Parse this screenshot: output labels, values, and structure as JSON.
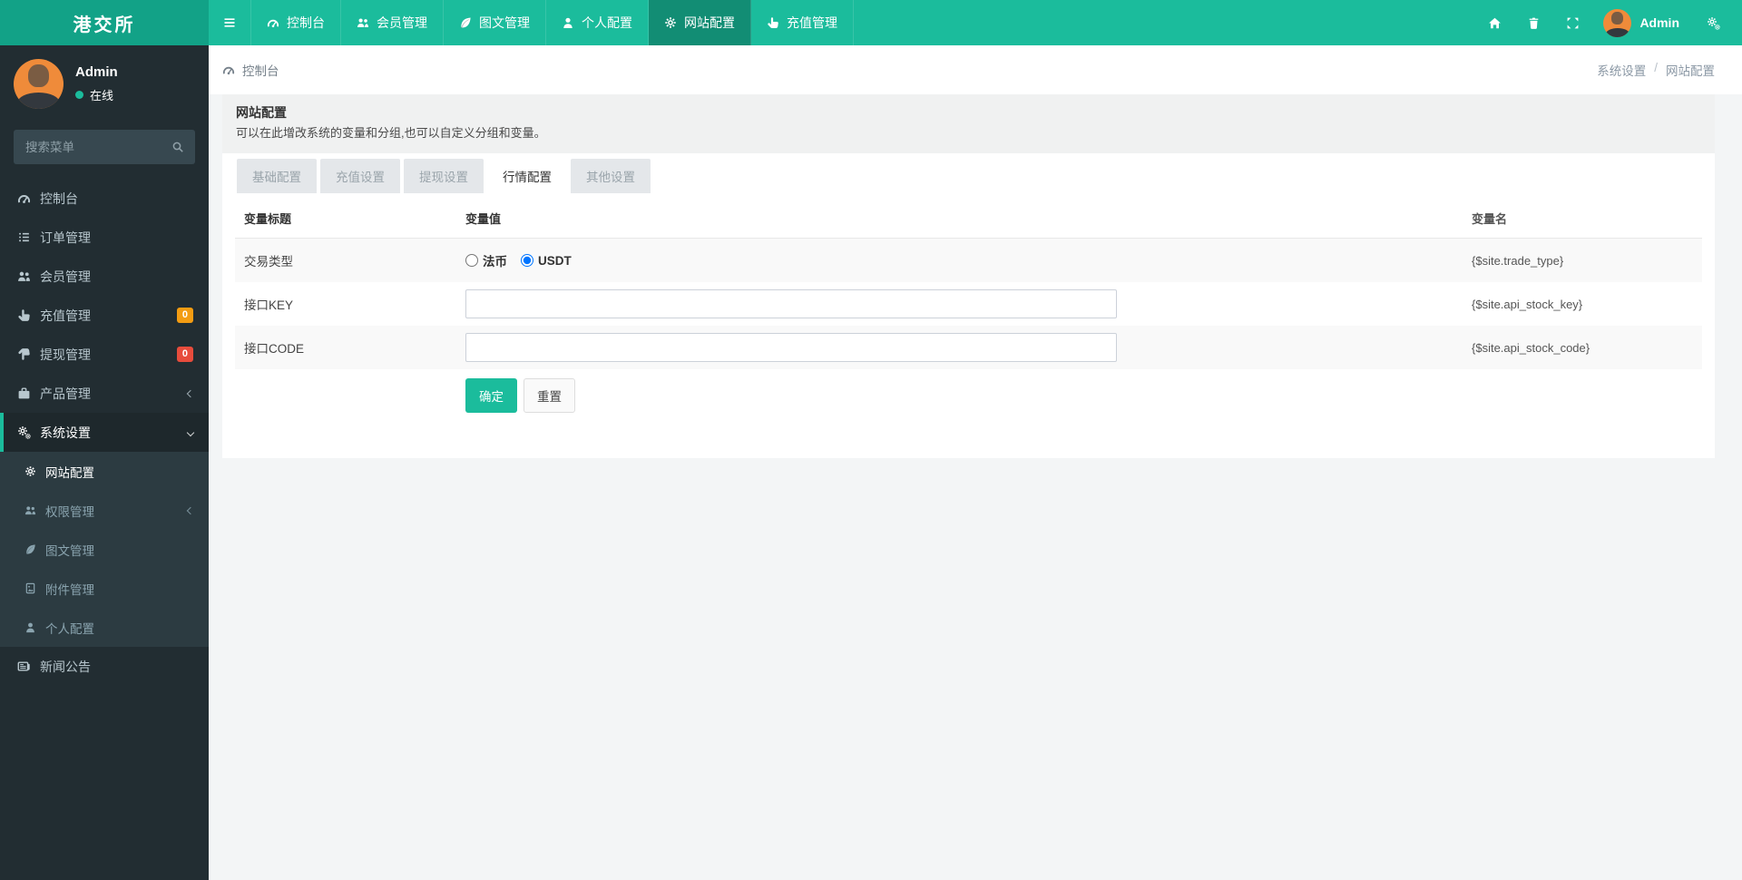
{
  "brand": {
    "title": "港交所"
  },
  "colors": {
    "navbar": "#1bbc9c",
    "navbar_logo": "#12a287",
    "navbar_active": "#128d74",
    "sidebar": "#222d32",
    "sidebar_submenu": "#2c3b41",
    "sidebar_active_bg": "#1e282c",
    "accent": "#1bbc9c",
    "badge_recharge": "#f39c12",
    "badge_withdraw": "#e74c3c",
    "submit_button": "#1bbc9c"
  },
  "navbar": {
    "toggle_icon": "bars-icon",
    "items": [
      {
        "key": "dashboard",
        "icon": "gauge-icon",
        "label": "控制台"
      },
      {
        "key": "members",
        "icon": "users-icon",
        "label": "会员管理"
      },
      {
        "key": "content",
        "icon": "leaf-icon",
        "label": "图文管理"
      },
      {
        "key": "profile",
        "icon": "user-icon",
        "label": "个人配置"
      },
      {
        "key": "site-config",
        "icon": "gear-icon",
        "label": "网站配置",
        "active": true
      },
      {
        "key": "recharge",
        "icon": "hand-up-icon",
        "label": "充值管理"
      }
    ],
    "right": {
      "icons": [
        "home-icon",
        "trash-icon",
        "fullscreen-icon"
      ],
      "username": "Admin",
      "menu_icon": "cogs-icon"
    }
  },
  "sidebar": {
    "user": {
      "name": "Admin",
      "status": "在线"
    },
    "search_placeholder": "搜索菜单",
    "items": [
      {
        "key": "dashboard",
        "icon": "gauge-icon",
        "label": "控制台"
      },
      {
        "key": "orders",
        "icon": "list-icon",
        "label": "订单管理"
      },
      {
        "key": "members",
        "icon": "users-icon",
        "label": "会员管理"
      },
      {
        "key": "recharge",
        "icon": "hand-up-icon",
        "label": "充值管理",
        "badge": "0",
        "badge_color": "#f39c12"
      },
      {
        "key": "withdraw",
        "icon": "hand-down-icon",
        "label": "提现管理",
        "badge": "0",
        "badge_color": "#e74c3c"
      },
      {
        "key": "products",
        "icon": "suitcase-icon",
        "label": "产品管理",
        "chevron": "left"
      },
      {
        "key": "system-settings",
        "icon": "cogs-icon",
        "label": "系统设置",
        "chevron": "down",
        "active": true,
        "children": [
          {
            "key": "site-config",
            "icon": "gear-icon",
            "label": "网站配置",
            "active": true
          },
          {
            "key": "permissions",
            "icon": "users-icon",
            "label": "权限管理",
            "chevron": "left"
          },
          {
            "key": "content",
            "icon": "leaf-icon",
            "label": "图文管理"
          },
          {
            "key": "attachments",
            "icon": "file-image-icon",
            "label": "附件管理"
          },
          {
            "key": "profile",
            "icon": "user-icon",
            "label": "个人配置"
          }
        ]
      },
      {
        "key": "news",
        "icon": "newspaper-icon",
        "label": "新闻公告"
      }
    ]
  },
  "breadcrumb": {
    "left": "控制台",
    "left_icon": "gauge-icon",
    "path": [
      "系统设置",
      "网站配置"
    ],
    "separator": "/"
  },
  "panel": {
    "title": "网站配置",
    "description": "可以在此增改系统的变量和分组,也可以自定义分组和变量。"
  },
  "tabs": [
    {
      "key": "basic",
      "label": "基础配置"
    },
    {
      "key": "recharge",
      "label": "充值设置"
    },
    {
      "key": "withdraw",
      "label": "提现设置"
    },
    {
      "key": "market",
      "label": "行情配置",
      "active": true
    },
    {
      "key": "other",
      "label": "其他设置"
    }
  ],
  "table": {
    "headers": [
      "变量标题",
      "变量值",
      "变量名"
    ],
    "rows": [
      {
        "title": "交易类型",
        "type": "radio",
        "var": "{$site.trade_type}",
        "options": [
          {
            "key": "fiat",
            "label": "法币",
            "checked": false
          },
          {
            "key": "usdt",
            "label": "USDT",
            "checked": true
          }
        ]
      },
      {
        "title": "接口KEY",
        "type": "text",
        "value": "",
        "input_name": "api-key-input",
        "var": "{$site.api_stock_key}"
      },
      {
        "title": "接口CODE",
        "type": "text",
        "value": "",
        "input_name": "api-code-input",
        "var": "{$site.api_stock_code}"
      }
    ]
  },
  "buttons": {
    "submit": "确定",
    "reset": "重置"
  }
}
